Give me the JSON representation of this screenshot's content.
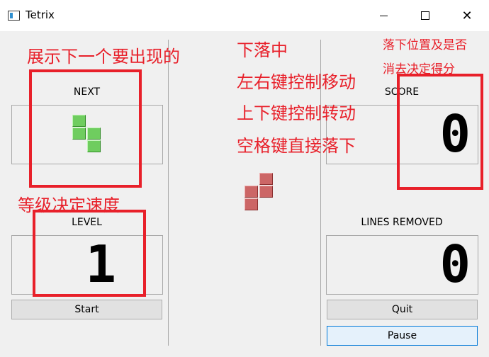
{
  "window": {
    "title": "Tetrix",
    "minimize_icon": "minimize-icon",
    "maximize_icon": "maximize-icon",
    "close_icon": "close-icon"
  },
  "labels": {
    "next": "NEXT",
    "level": "LEVEL",
    "score": "SCORE",
    "lines_removed": "LINES REMOVED"
  },
  "values": {
    "level": "1",
    "score": "0",
    "lines_removed": "0"
  },
  "buttons": {
    "start": "Start",
    "quit": "Quit",
    "pause": "Pause"
  },
  "annotations": {
    "next_hint": "展示下一个要出现的",
    "level_hint": "等级决定速度",
    "falling": "下落中",
    "left_right": "左右键控制移动",
    "up_down": "上下键控制转动",
    "space": "空格键直接落下",
    "score_hint_line1": "落下位置及是否",
    "score_hint_line2": "消去决定得分"
  },
  "colors": {
    "annotation_red": "#e8202a",
    "next_piece": "#6fcd5f",
    "falling_piece": "#cc6666"
  }
}
